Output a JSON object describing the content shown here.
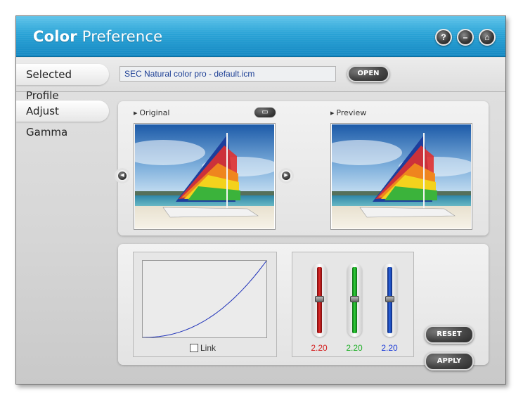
{
  "window": {
    "title_bold": "Color",
    "title_rest": "Preference",
    "buttons": [
      {
        "icon": "help-icon",
        "glyph": "?"
      },
      {
        "icon": "minimize-icon",
        "glyph": "–"
      },
      {
        "icon": "home-icon",
        "glyph": "⌂"
      }
    ]
  },
  "profile": {
    "label": "Selected Profile",
    "value": "SEC Natural color pro - default.icm",
    "open_label": "OPEN"
  },
  "gamma": {
    "tab_label": "Adjust Gamma",
    "original_label": "Original",
    "preview_label": "Preview",
    "link_label": "Link",
    "link_checked": false,
    "sliders": [
      {
        "channel": "red",
        "value": "2.20",
        "color": "#d42020"
      },
      {
        "channel": "green",
        "value": "2.20",
        "color": "#22b02a"
      },
      {
        "channel": "blue",
        "value": "2.20",
        "color": "#2240d8"
      }
    ],
    "curve_color": "#1c2fb8",
    "reset_label": "RESET",
    "apply_label": "APPLY"
  },
  "colors": {
    "titlebar": "#1e95cc"
  }
}
